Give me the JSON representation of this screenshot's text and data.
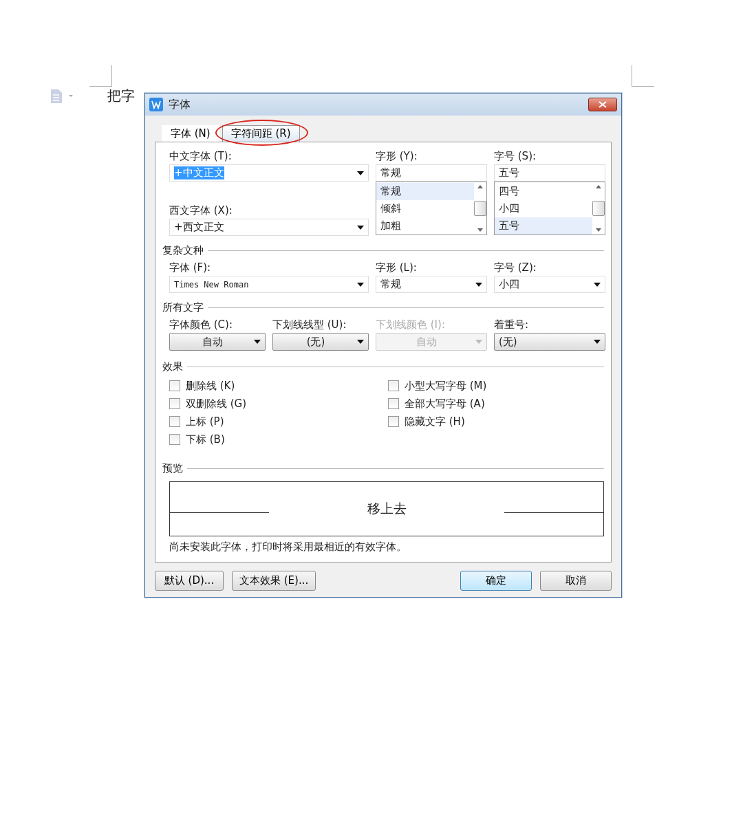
{
  "document": {
    "text": "把字"
  },
  "dialog": {
    "title": "字体",
    "tabs": [
      {
        "label": "字体 (N)",
        "selected": true,
        "circled": false
      },
      {
        "label": "字符间距 (R)",
        "selected": false,
        "circled": true
      }
    ],
    "chinese_font": {
      "label": "中文字体 (T):",
      "value": "+中文正文"
    },
    "western_font": {
      "label": "西文字体 (X):",
      "value": "+西文正文"
    },
    "style": {
      "label": "字形 (Y):",
      "value": "常规",
      "options": [
        {
          "label": "常规",
          "selected": true
        },
        {
          "label": "倾斜",
          "selected": false
        },
        {
          "label": "加粗",
          "selected": false
        }
      ]
    },
    "size": {
      "label": "字号 (S):",
      "value": "五号",
      "options": [
        {
          "label": "四号",
          "selected": false
        },
        {
          "label": "小四",
          "selected": false
        },
        {
          "label": "五号",
          "selected": true
        }
      ]
    },
    "complex": {
      "heading": "复杂文种",
      "fields": [
        {
          "label": "字体 (F):",
          "value": "Times New Roman"
        },
        {
          "label": "字形 (L):",
          "value": "常规"
        },
        {
          "label": "字号 (Z):",
          "value": "小四"
        }
      ]
    },
    "all_text": {
      "heading": "所有文字",
      "fields": [
        {
          "label": "字体颜色 (C):",
          "value": "自动",
          "disabled": false
        },
        {
          "label": "下划线线型 (U):",
          "value": "(无)",
          "disabled": false
        },
        {
          "label": "下划线颜色 (I):",
          "value": "自动",
          "disabled": true
        },
        {
          "label": "着重号:",
          "value": "(无)",
          "disabled": false
        }
      ]
    },
    "effects": {
      "heading": "效果",
      "items": [
        {
          "label": "删除线 (K)",
          "checked": false
        },
        {
          "label": "双删除线 (G)",
          "checked": false
        },
        {
          "label": "上标 (P)",
          "checked": false
        },
        {
          "label": "下标 (B)",
          "checked": false
        },
        {
          "label": "小型大写字母 (M)",
          "checked": false
        },
        {
          "label": "全部大写字母 (A)",
          "checked": false
        },
        {
          "label": "隐藏文字 (H)",
          "checked": false
        }
      ]
    },
    "preview": {
      "heading": "预览",
      "sample": "移上去",
      "note": "尚未安装此字体，打印时将采用最相近的有效字体。"
    },
    "buttons": [
      {
        "label": "默认 (D)...",
        "kind": "left"
      },
      {
        "label": "文本效果 (E)...",
        "kind": "left"
      },
      {
        "label": "确定",
        "kind": "primary"
      },
      {
        "label": "取消",
        "kind": "right"
      }
    ]
  }
}
